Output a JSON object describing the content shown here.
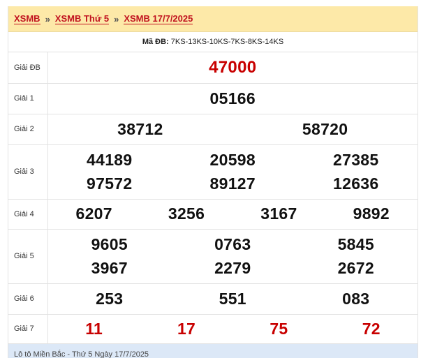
{
  "breadcrumb": [
    "XSMB",
    "XSMB Thứ 5",
    "XSMB 17/7/2025"
  ],
  "breadcrumb_sep": "»",
  "code": {
    "label": "Mã ĐB:",
    "value": "7KS-13KS-10KS-7KS-8KS-14KS"
  },
  "prizes": {
    "db": {
      "label": "Giải ĐB",
      "numbers": [
        "47000"
      ]
    },
    "g1": {
      "label": "Giải 1",
      "numbers": [
        "05166"
      ]
    },
    "g2": {
      "label": "Giải 2",
      "numbers": [
        "38712",
        "58720"
      ]
    },
    "g3": {
      "label": "Giải 3",
      "numbers": [
        "44189",
        "20598",
        "27385",
        "97572",
        "89127",
        "12636"
      ]
    },
    "g4": {
      "label": "Giải 4",
      "numbers": [
        "6207",
        "3256",
        "3167",
        "9892"
      ]
    },
    "g5": {
      "label": "Giải 5",
      "numbers": [
        "9605",
        "0763",
        "5845",
        "3967",
        "2279",
        "2672"
      ]
    },
    "g6": {
      "label": "Giải 6",
      "numbers": [
        "253",
        "551",
        "083"
      ]
    },
    "g7": {
      "label": "Giải 7",
      "numbers": [
        "11",
        "17",
        "75",
        "72"
      ]
    }
  },
  "footer": "Lô tô Miền Bắc - Thứ 5 Ngày 17/7/2025",
  "colors": {
    "red": "#c80000",
    "breadcrumb_bg": "#fde9a8",
    "footer_bg": "#dce8f7"
  }
}
